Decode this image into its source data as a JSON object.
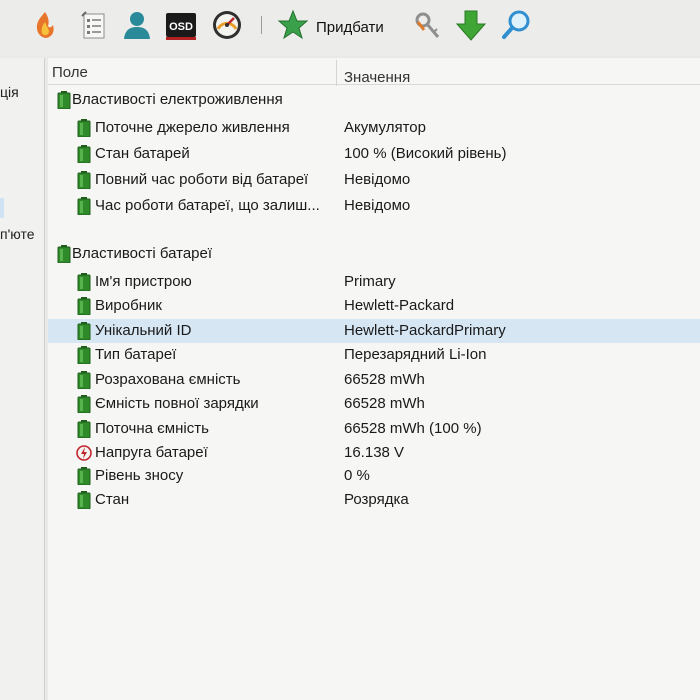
{
  "toolbar": {
    "icons": [
      "flame-icon",
      "checklist-icon",
      "user-icon",
      "osd-icon",
      "gauge-icon",
      "add-star-icon",
      "key-icon",
      "download-arrow-icon",
      "search-icon"
    ],
    "osd_text": "OSD",
    "add_label": "Придбати"
  },
  "left_pane": {
    "item_1": "ція",
    "item_2": "п'юте"
  },
  "list": {
    "col_field": "Поле",
    "col_value": "Значення",
    "groups": [
      {
        "title": "Властивості електроживлення",
        "items": [
          {
            "field": "Поточне джерело живлення",
            "value": "Акумулятор"
          },
          {
            "field": "Стан батарей",
            "value": "100 % (Високий рівень)"
          },
          {
            "field": "Повний час роботи від батареї",
            "value": "Невідомо"
          },
          {
            "field": "Час роботи батареї, що залиш...",
            "value": "Невідомо"
          }
        ]
      },
      {
        "title": "Властивості батареї",
        "items": [
          {
            "field": "Ім'я пристрою",
            "value": "Primary"
          },
          {
            "field": "Виробник",
            "value": "Hewlett-Packard"
          },
          {
            "field": "Унікальний ID",
            "value": "Hewlett-PackardPrimary",
            "selected": true
          },
          {
            "field": "Тип батареї",
            "value": "Перезарядний Li-Ion"
          },
          {
            "field": "Розрахована ємність",
            "value": "66528 mWh"
          },
          {
            "field": "Ємність повної зарядки",
            "value": "66528 mWh"
          },
          {
            "field": "Поточна ємність",
            "value": "66528 mWh  (100 %)"
          },
          {
            "field": "Напруга батареї",
            "value": "16.138 V",
            "icon": "voltage-icon"
          },
          {
            "field": "Рівень зносу",
            "value": "0 %"
          },
          {
            "field": "Стан",
            "value": "Розрядка"
          }
        ]
      }
    ]
  },
  "colors": {
    "battery_green": "#2f8a2a",
    "selection": "#d6e6f3",
    "star_green": "#3aa14a",
    "arrow_green": "#3fa535",
    "search_blue": "#2f8fd0"
  }
}
